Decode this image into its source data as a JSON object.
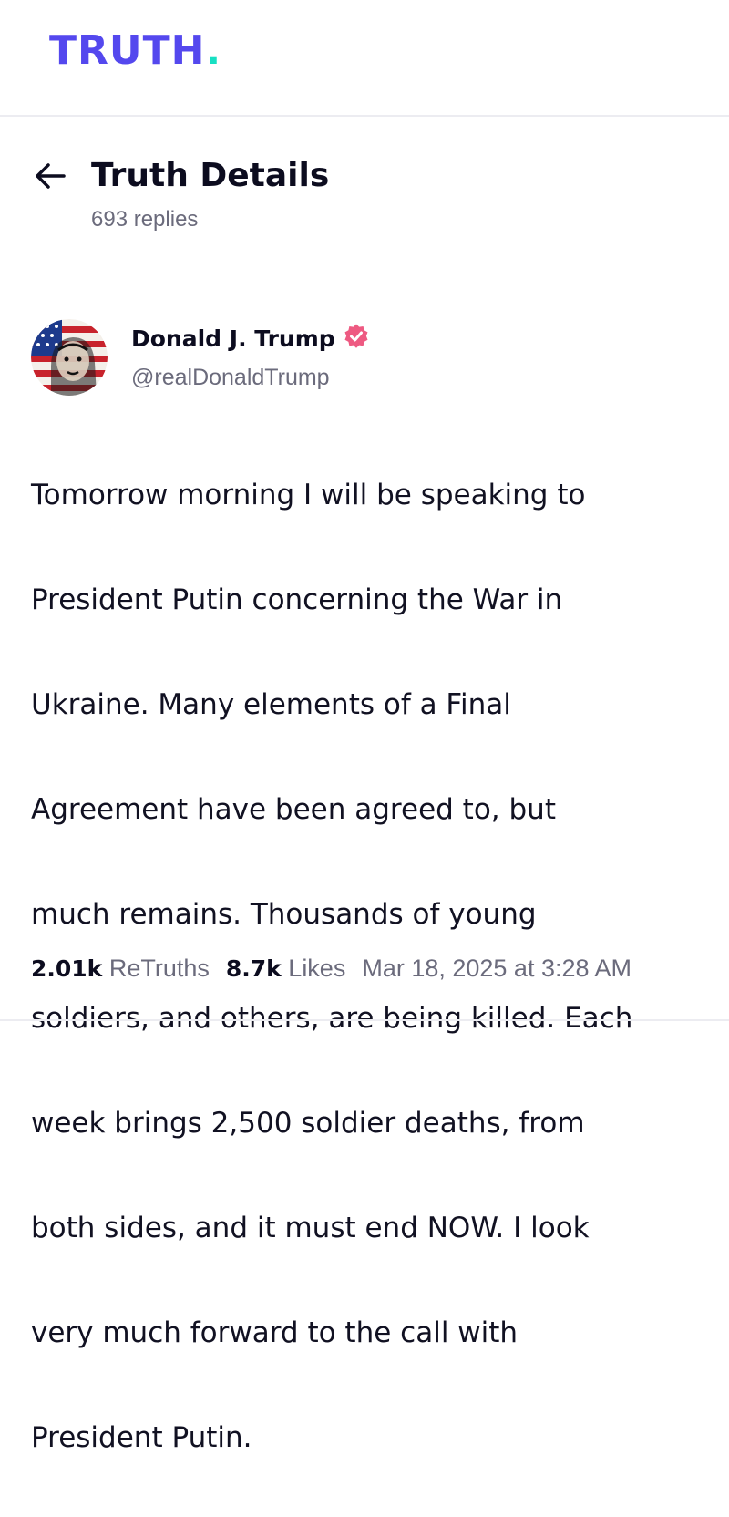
{
  "app": {
    "logo_text": "TRUTH",
    "logo_dot": ".",
    "brand_color": "#5448ee",
    "accent_color": "#17e0c3"
  },
  "header": {
    "back_icon": "arrow-left-icon",
    "title": "Truth Details",
    "replies": "693 replies"
  },
  "post": {
    "author_name": "Donald J. Trump",
    "verified_icon": "verified-badge-icon",
    "verified_color": "#ee5a82",
    "handle": "@realDonaldTrump",
    "lines": [
      "Tomorrow morning I will be speaking to",
      "President Putin concerning the War in",
      "Ukraine. Many elements of a Final",
      "Agreement have been agreed to, but",
      "much remains. Thousands of young",
      "soldiers, and others, are being killed. Each",
      "week brings 2,500 soldier deaths, from",
      "both sides, and it must end NOW. I look",
      "very much forward to the call with",
      "President Putin."
    ],
    "retruths_count": "2.01k",
    "retruths_label": "ReTruths",
    "likes_count": "8.7k",
    "likes_label": "Likes",
    "timestamp": "Mar 18, 2025 at 3:28 AM"
  }
}
